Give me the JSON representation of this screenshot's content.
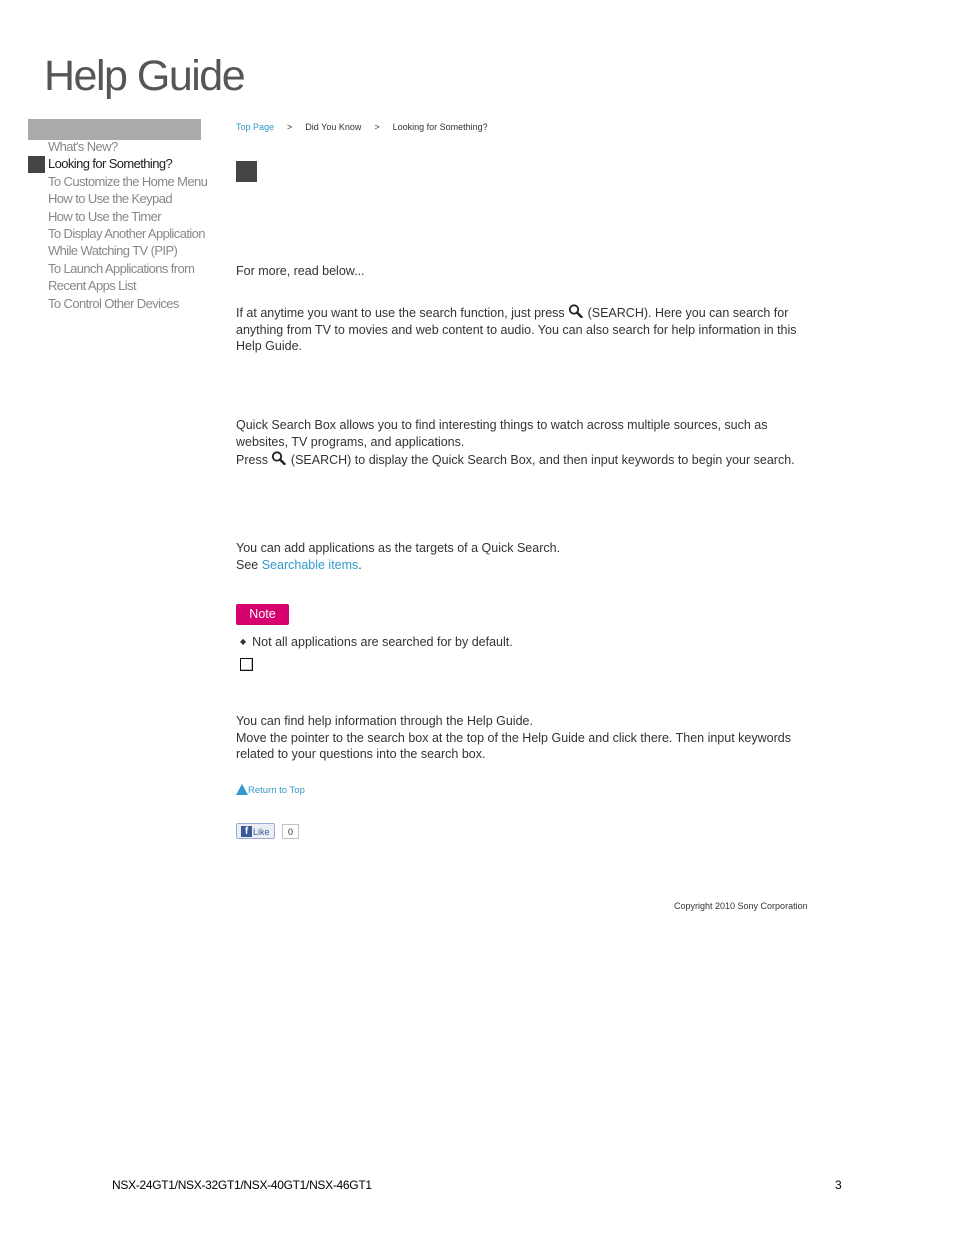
{
  "header": {
    "logo": "Help Guide"
  },
  "sidebar": {
    "items": [
      {
        "label": "What's New?",
        "active": false
      },
      {
        "label": "Looking for Something?",
        "active": true
      },
      {
        "label": "To Customize the Home Menu",
        "active": false
      },
      {
        "label": "How to Use the Keypad",
        "active": false
      },
      {
        "label": "How to Use the Timer",
        "active": false
      },
      {
        "label": "To Display Another Application While Watching TV (PIP)",
        "active": false
      },
      {
        "label": "To Launch Applications from Recent Apps List",
        "active": false
      },
      {
        "label": "To Control Other Devices",
        "active": false
      }
    ]
  },
  "breadcrumb": {
    "items": [
      "Top Page",
      "Did You Know",
      "Looking for Something?"
    ],
    "separator": ">"
  },
  "content": {
    "intro": "For more, read below...",
    "search_para_before": "If at anytime you want to use the search function, just press ",
    "search_para_after": " (SEARCH). Here you can search for anything from TV to movies and web content to audio. You can also search for help information in this Help Guide.",
    "qsb_para1": "Quick Search Box allows you to find interesting things to watch across multiple sources, such as websites, TV programs, and applications.",
    "qsb_para2_before": "Press ",
    "qsb_para2_after": " (SEARCH) to display the Quick Search Box, and then input keywords to begin your search.",
    "apps_para1": "You can add applications as the targets of a Quick Search.",
    "apps_see": "See ",
    "apps_link": "Searchable items",
    "apps_period": ".",
    "note_label": "Note",
    "note_items": [
      "Not all applications are searched for by default."
    ],
    "help_para1": "You can find help information through the Help Guide.",
    "help_para2": "Move the pointer to the search box at the top of the Help Guide and click there. Then input keywords related to your questions into the search box.",
    "return_top": "Return to Top",
    "like_label": "Like",
    "like_count": "0"
  },
  "footer": {
    "copyright": "Copyright 2010 Sony Corporation",
    "model": "NSX-24GT1/NSX-32GT1/NSX-40GT1/NSX-46GT1",
    "page_number": "3"
  },
  "colors": {
    "accent_link": "#3399cc",
    "note_badge": "#d6006e",
    "sidebar_bar": "#aaaaaa"
  }
}
